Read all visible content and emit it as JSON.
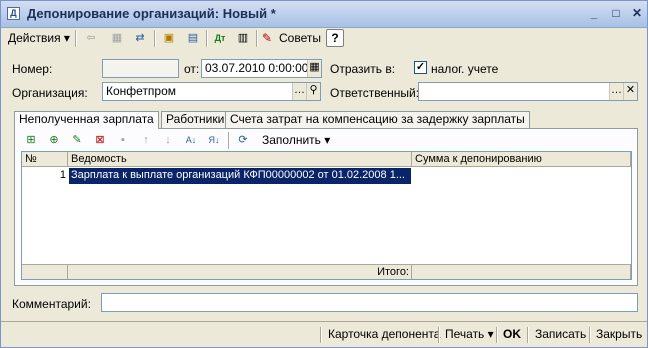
{
  "window": {
    "title": "Депонирование организаций: Новый *"
  },
  "toolbar": {
    "actions_label": "Действия ▾",
    "advice_label": "Советы",
    "help_label": "?"
  },
  "form": {
    "number_label": "Номер:",
    "number_value": "",
    "date_label": "от:",
    "date_value": "03.07.2010  0:00:00",
    "reflect_label": "Отразить в:",
    "tax_checkbox_label": "налог. учете",
    "tax_checked": true,
    "organization_label": "Организация:",
    "organization_value": "Конфетпром",
    "responsible_label": "Ответственный:",
    "responsible_value": ""
  },
  "tabs": [
    {
      "label": "Неполученная зарплата",
      "active": true
    },
    {
      "label": "Работники",
      "active": false
    },
    {
      "label": "Счета затрат на компенсацию за задержку зарплаты",
      "active": false
    }
  ],
  "tab_toolbar": {
    "fill_label": "Заполнить ▾"
  },
  "table": {
    "columns": [
      "№",
      "Ведомость",
      "Сумма к депонированию"
    ],
    "rows": [
      {
        "n": "1",
        "statement": "Зарплата к выплате организаций КФП00000002 от 01.02.2008 1...",
        "amount": ""
      }
    ],
    "total_label": "Итого:",
    "total_value": ""
  },
  "comment": {
    "label": "Комментарий:",
    "value": ""
  },
  "footer": {
    "card_label": "Карточка депонента",
    "print_label": "Печать ▾",
    "ok_label": "OK",
    "save_label": "Записать",
    "close_label": "Закрыть"
  }
}
